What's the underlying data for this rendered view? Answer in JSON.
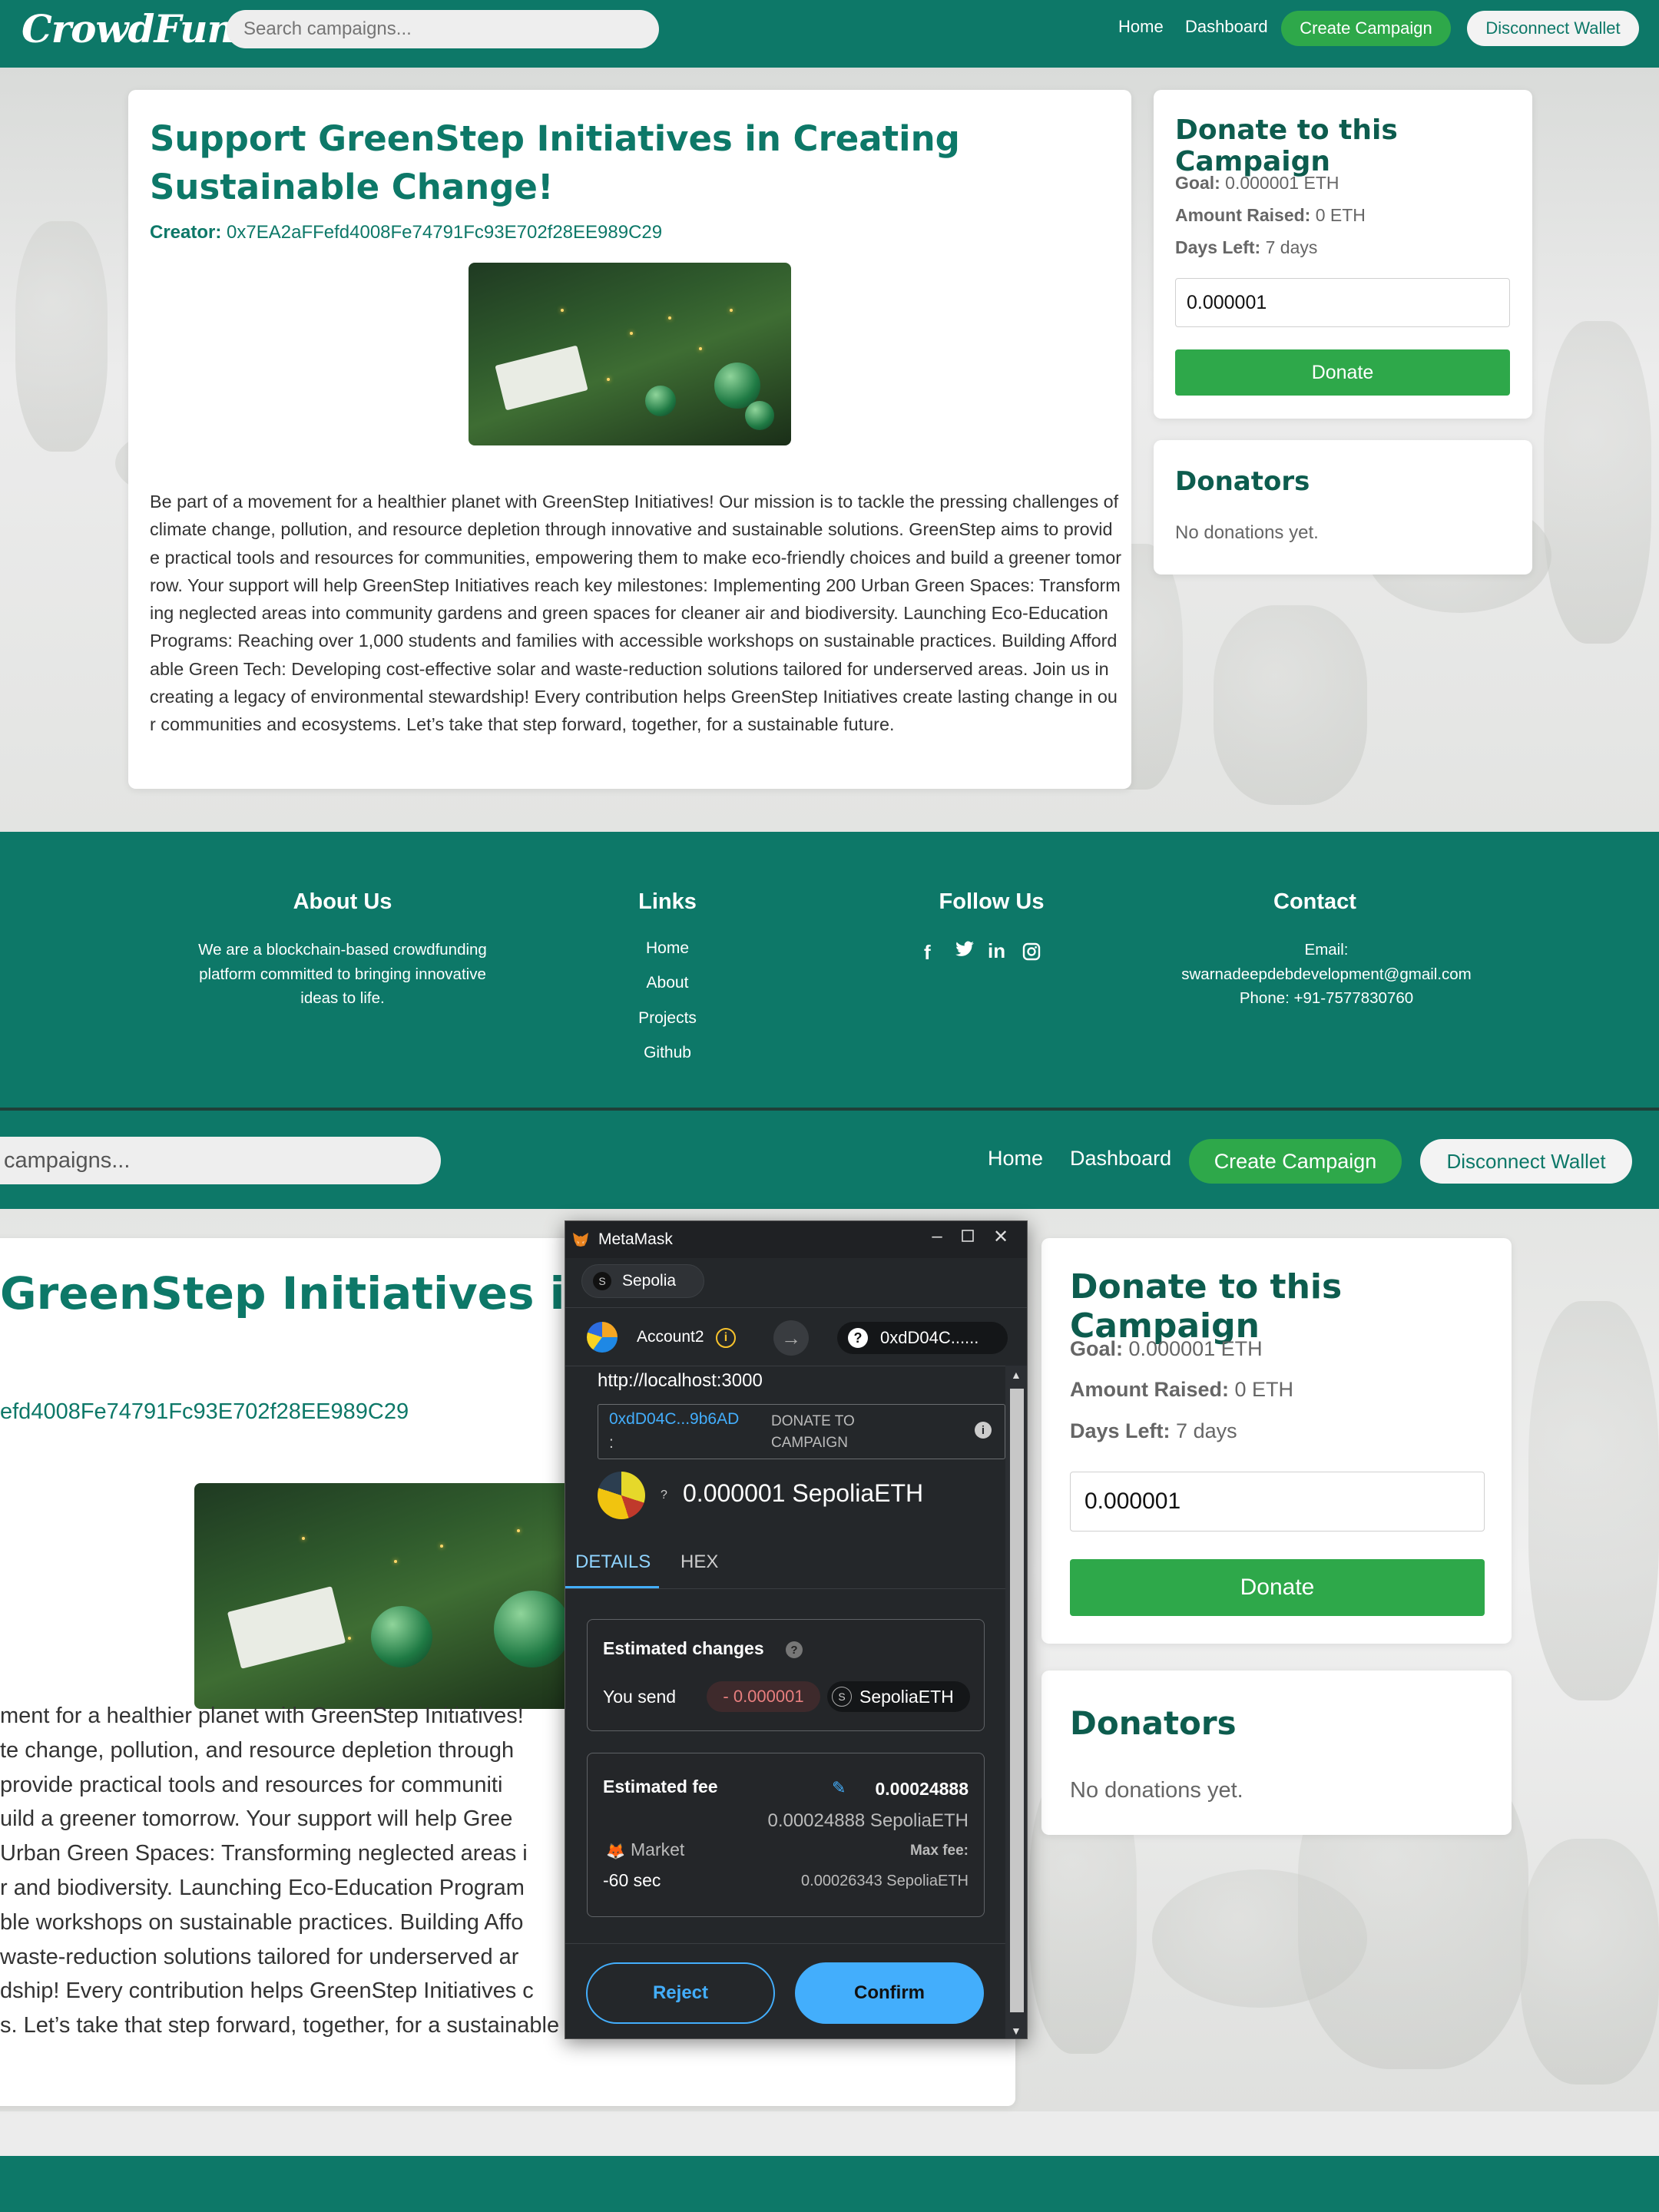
{
  "brand": {
    "logo": "CrowdFund",
    "primary": "#0d7868",
    "accent_green": "#2ea84a"
  },
  "nav": {
    "search_placeholder": "Search campaigns...",
    "home": "Home",
    "dashboard": "Dashboard",
    "create_campaign": "Create Campaign",
    "disconnect_wallet": "Disconnect Wallet"
  },
  "campaign": {
    "title": "Support GreenStep Initiatives in Creating Sustainable Change!",
    "creator_label": "Creator:",
    "creator_address": "0x7EA2aFFefd4008Fe74791Fc93E702f28EE989C29",
    "description": "Be part of a movement for a healthier planet with GreenStep Initiatives! Our mission is to tackle the pressing challenges of climate change, pollution, and resource depletion through innovative and sustainable solutions. GreenStep aims to provide practical tools and resources for communities, empowering them to make eco-friendly choices and build a greener tomorrow. Your support will help GreenStep Initiatives reach key milestones: Implementing 200 Urban Green Spaces: Transforming neglected areas into community gardens and green spaces for cleaner air and biodiversity. Launching Eco-Education Programs: Reaching over 1,000 students and families with accessible workshops on sustainable practices. Building Affordable Green Tech: Developing cost-effective solar and waste-reduction solutions tailored for underserved areas. Join us in creating a legacy of environmental stewardship! Every contribution helps GreenStep Initiatives create lasting change in our communities and ecosystems. Let’s take that step forward, together, for a sustainable future."
  },
  "donate": {
    "title": "Donate to this Campaign",
    "goal_label": "Goal:",
    "goal_value": "0.000001 ETH",
    "raised_label": "Amount Raised:",
    "raised_value": "0 ETH",
    "days_label": "Days Left:",
    "days_value": "7 days",
    "amount_value": "0.000001",
    "button": "Donate"
  },
  "donators": {
    "title": "Donators",
    "empty": "No donations yet."
  },
  "footer": {
    "about_title": "About Us",
    "about_text": "We are a blockchain-based crowdfunding platform committed to bringing innovative ideas to life.",
    "links_title": "Links",
    "links": [
      "Home",
      "About",
      "Projects",
      "Github"
    ],
    "follow_title": "Follow Us",
    "social_icons": [
      "facebook-icon",
      "twitter-icon",
      "linkedin-icon",
      "instagram-icon"
    ],
    "contact_title": "Contact",
    "email_label": "Email:",
    "email": "swarnadeepdebdevelopment@gmail.com",
    "phone": "Phone: +91-7577830760"
  },
  "bottom": {
    "search_text": "campaigns...",
    "title_partial": "GreenStep Initiatives in Cr",
    "creator_partial": "efd4008Fe74791Fc93E702f28EE989C29",
    "desc_lines": [
      "ment for a healthier planet with GreenStep Initiatives!",
      "te change, pollution, and resource depletion through",
      " provide practical tools and resources for communiti",
      "uild a greener tomorrow. Your support will help Gree",
      "Urban Green Spaces: Transforming neglected areas i",
      "r and biodiversity. Launching Eco-Education Program",
      "ble workshops on sustainable practices. Building Affo",
      "waste-reduction solutions tailored for underserved ar",
      "dship! Every contribution helps GreenStep Initiatives c",
      "s. Let’s take that step forward, together, for a sustainable future."
    ]
  },
  "metamask": {
    "window_title": "MetaMask",
    "network": "Sepolia",
    "network_badge": "S",
    "account": "Account2",
    "to_address": "0xdD04C......",
    "origin": "http://localhost:3000",
    "method_address": "0xdD04C...9b6AD",
    "method_colon": ":",
    "method_label": "DONATE TO CAMPAIGN",
    "amount": "0.000001 SepoliaETH",
    "tab_details": "DETAILS",
    "tab_hex": "HEX",
    "est_changes_title": "Estimated changes",
    "you_send": "You send",
    "send_value": "- 0.000001",
    "send_token": "SepoliaETH",
    "est_fee_title": "Estimated fee",
    "fee_value": "0.00024888",
    "fee_eth": "0.00024888 SepoliaETH",
    "market": "Market",
    "max_fee_label": "Max fee:",
    "time": "-60 sec",
    "max_fee_value": "0.00026343 SepoliaETH",
    "reject": "Reject",
    "confirm": "Confirm",
    "accent": "#43aefc"
  }
}
